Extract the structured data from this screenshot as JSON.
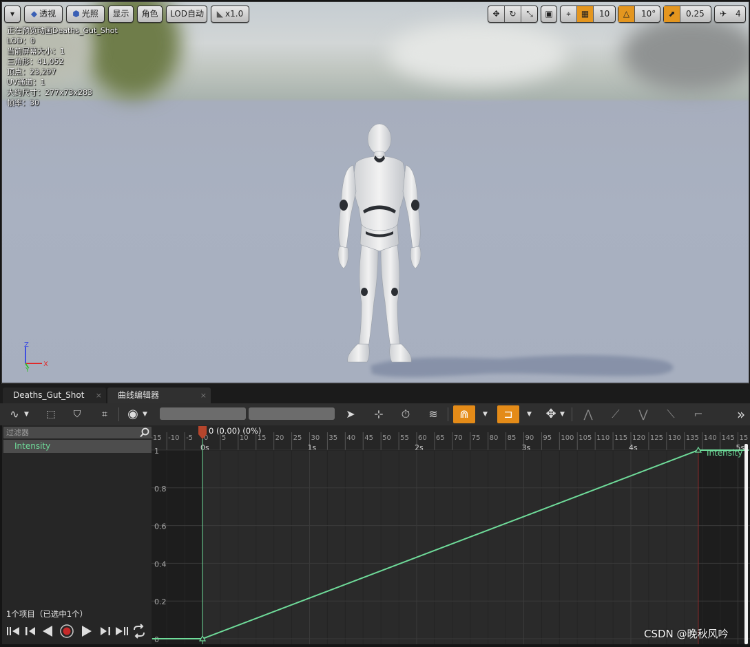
{
  "viewport": {
    "toolbar": {
      "menu_label": "▾",
      "perspective": "透视",
      "lit": "光照",
      "show": "显示",
      "character": "角色",
      "lod": "LOD自动",
      "speed": "x1.0",
      "grid_snap": "10",
      "rotate_snap": "10°",
      "scale_snap": "0.25",
      "camera_speed": "4"
    },
    "stats": {
      "previewing": "正在预览动画Deaths_Gut_Shot",
      "lod": "LOD：0",
      "screen_size": "当前屏幕大小：1",
      "triangles": "三角形：41,052",
      "vertices": "顶点：23,297",
      "uv_channels": "UV通道：1",
      "approx_size": "大约尺寸：277x73x283",
      "frame_rate": "帧率：30"
    },
    "gizmo": {
      "z": "Z",
      "x": "X",
      "y": "Y"
    }
  },
  "tabs": [
    {
      "label": "Deaths_Gut_Shot",
      "close": "×"
    },
    {
      "label": "曲线编辑器",
      "close": "×"
    }
  ],
  "curve_panel": {
    "filter_placeholder": "过滤器",
    "items": [
      {
        "name": "Intensity",
        "color": "#6fdc9a"
      }
    ],
    "item_count": "1个项目（已选中1个）"
  },
  "timeline": {
    "playhead_label": "0 (0.00) (0%)",
    "frame_ticks": [
      "-15",
      "-10",
      "-5",
      "0",
      "5",
      "10",
      "15",
      "20",
      "25",
      "30",
      "35",
      "40",
      "45",
      "50",
      "55",
      "60",
      "65",
      "70",
      "75",
      "80",
      "85",
      "90",
      "95",
      "100",
      "105",
      "110",
      "115",
      "120",
      "125",
      "130",
      "135",
      "140",
      "145",
      "15"
    ],
    "second_labels": [
      "0s",
      "1s",
      "2s",
      "3s",
      "4s",
      "5s"
    ],
    "y_labels": [
      "1",
      "0.8",
      "0.6",
      "0.4",
      "0.2",
      "0"
    ],
    "curve_label": "Intensity",
    "curve_color": "#6fdc9a"
  },
  "chart_data": {
    "type": "line",
    "xlabel": "",
    "ylabel": "",
    "xlim": [
      -0.47,
      5.1
    ],
    "ylim": [
      0,
      1
    ],
    "series": [
      {
        "name": "Intensity",
        "x": [
          -0.47,
          0,
          4.63,
          5.1
        ],
        "y": [
          0,
          0,
          1,
          1
        ]
      }
    ]
  },
  "watermark": "CSDN @晚秋风吟"
}
